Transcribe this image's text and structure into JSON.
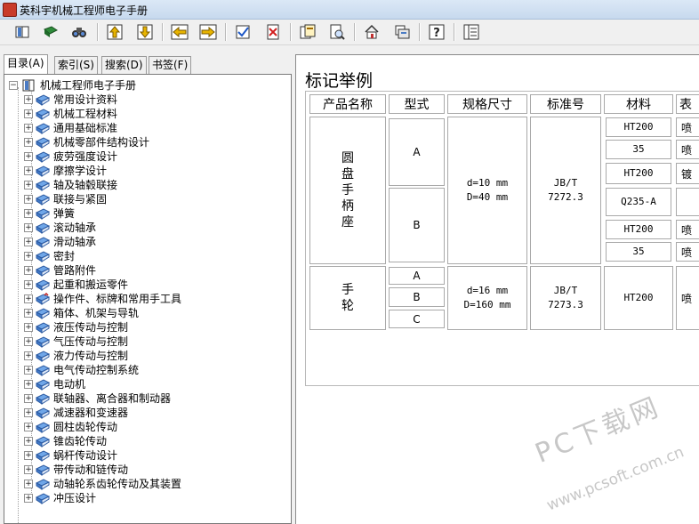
{
  "window": {
    "title": "英科宇机械工程师电子手册"
  },
  "toolbar": {
    "buttons": [
      "book-open-icon",
      "book-closed-icon",
      "binoculars-icon",
      "arrow-up-icon",
      "arrow-down-icon",
      "arrow-left-icon",
      "arrow-right-icon",
      "check-doc-icon",
      "close-doc-icon",
      "copy-icon",
      "preview-icon",
      "home-icon",
      "print-icon",
      "help-icon",
      "panel-icon"
    ]
  },
  "tabs": [
    {
      "label": "目录(A)"
    },
    {
      "label": "索引(S)"
    },
    {
      "label": "搜索(D)"
    },
    {
      "label": "书签(F)"
    }
  ],
  "tree": {
    "root": "机械工程师电子手册",
    "items": [
      "常用设计资料",
      "机械工程材料",
      "通用基础标准",
      "机械零部件结构设计",
      "疲劳强度设计",
      "摩擦学设计",
      "轴及轴毂联接",
      "联接与紧固",
      "弹簧",
      "滚动轴承",
      "滑动轴承",
      "密封",
      "管路附件",
      "起重和搬运零件",
      "操作件、标牌和常用手工具",
      "箱体、机架与导轨",
      "液压传动与控制",
      "气压传动与控制",
      "液力传动与控制",
      "电气传动控制系统",
      "电动机",
      "联轴器、离合器和制动器",
      "减速器和变速器",
      "圆柱齿轮传动",
      "锥齿轮传动",
      "蜗杆传动设计",
      "带传动和链传动",
      "动轴轮系齿轮传动及其装置",
      "冲压设计"
    ]
  },
  "content": {
    "title": "标记举例",
    "headers": [
      "产品名称",
      "型式",
      "规格尺寸",
      "标准号",
      "材料",
      "表"
    ],
    "row1": {
      "name": "圆盘手柄座",
      "types": [
        "A",
        "B"
      ],
      "spec_line1": "d=10 mm",
      "spec_line2": "D=40 mm",
      "std_line1": "JB/T",
      "std_line2": "7272.3",
      "materials": [
        "HT200",
        "35",
        "HT200",
        "Q235-A",
        "HT200",
        "35"
      ],
      "surface": [
        "喷",
        "喷",
        "镀",
        "",
        "喷",
        "喷"
      ]
    },
    "row2": {
      "name": "手轮",
      "types": [
        "A",
        "B",
        "C"
      ],
      "spec_line1": "d=16 mm",
      "spec_line2": "D=160 mm",
      "std_line1": "JB/T",
      "std_line2": "7273.3",
      "material": "HT200",
      "surface": "喷"
    }
  },
  "watermark": {
    "main": "PC下载网",
    "url": "www.pcsoft.com.cn"
  }
}
